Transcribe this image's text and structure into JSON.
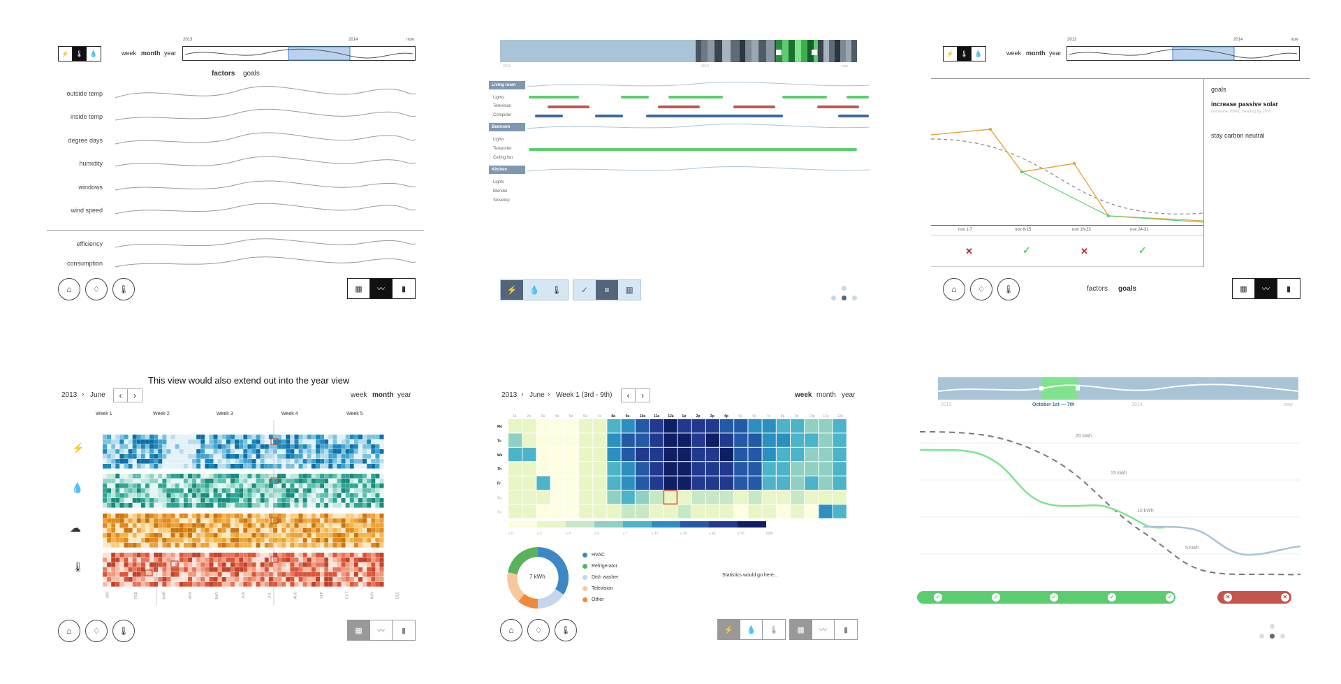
{
  "colors": {
    "green": "#5ccd6e",
    "red": "#c4554d",
    "blue": "#3b6a9c",
    "slate": "#7f98b0",
    "orange": "#e8a33d",
    "lightblue": "#a9c3d7"
  },
  "p1": {
    "timeline": {
      "start": "2013",
      "mid": "2014",
      "end": "now"
    },
    "period": {
      "week": "week",
      "month": "month",
      "year": "year"
    },
    "tabs": {
      "factors": "factors",
      "goals": "goals"
    },
    "rows": [
      "outside temp",
      "inside temp",
      "degree days",
      "humidity",
      "windows",
      "wind speed"
    ],
    "rows2": [
      "efficiency",
      "consumption"
    ],
    "icons": [
      "lightning-icon",
      "thermometer-icon",
      "drop-icon"
    ]
  },
  "p2": {
    "timeline": {
      "start": "2013",
      "mid": "2014",
      "end": "now"
    },
    "rooms": [
      {
        "name": "Living room",
        "items": [
          "Lights",
          "Television",
          "Computer"
        ]
      },
      {
        "name": "Bedroom",
        "items": [
          "Lights",
          "Teleporter",
          "Ceiling fan"
        ]
      },
      {
        "name": "Kitchen",
        "items": [
          "Lights",
          "Blender",
          "Stovetop"
        ]
      }
    ]
  },
  "p3": {
    "timeline": {
      "start": "2013",
      "mid": "2014",
      "end": "now"
    },
    "period": {
      "week": "week",
      "month": "month",
      "year": "year"
    },
    "goals_title": "goals",
    "goal1": "increase passive solar",
    "goal1_sub": "decrease HVAC heating by 20%",
    "goal2": "stay carbon neutral",
    "weeks": [
      "nov 1-7",
      "nov 8-15",
      "nov 16-23",
      "nov 24-31"
    ],
    "marks": [
      "✕",
      "✓",
      "✕",
      "✓"
    ],
    "tabs": {
      "factors": "factors",
      "goals": "goals"
    }
  },
  "p4": {
    "caption": "This view would also extend out into the year view",
    "crumb": {
      "year": "2013",
      "sep": "›",
      "month": "June"
    },
    "nav": {
      "prev": "‹",
      "next": "›"
    },
    "period": {
      "week": "week",
      "month": "month",
      "year": "year"
    },
    "weeks": [
      "Week 1",
      "Week 2",
      "Week 3",
      "Week 4",
      "Week 5"
    ],
    "months": [
      "JAN",
      "FEB",
      "MAR",
      "APR",
      "MAY",
      "JUN",
      "JUL",
      "AUG",
      "SEP",
      "OCT",
      "NOV",
      "DEC"
    ]
  },
  "p5": {
    "crumb": {
      "year": "2013",
      "sep1": "›",
      "month": "June",
      "sep2": "›",
      "week": "Week 1 (3rd - 9th)"
    },
    "nav": {
      "prev": "‹",
      "next": "›"
    },
    "period": {
      "week": "week",
      "month": "month",
      "year": "year"
    },
    "hours": [
      "1a",
      "2a",
      "3a",
      "4a",
      "5a",
      "6a",
      "7a",
      "8a",
      "9a",
      "10a",
      "11a",
      "12a",
      "1p",
      "2p",
      "3p",
      "4p",
      "5p",
      "6p",
      "7p",
      "8p",
      "9p",
      "10p",
      "11p",
      "12p"
    ],
    "days": [
      "Mo",
      "Tu",
      "We",
      "Th",
      "Fr",
      "Sa",
      "Su"
    ],
    "scale": [
      "≤ 0",
      "≤ 2",
      "≤ 4",
      "≤ 5",
      "≤ 7",
      "≤ 15",
      "≤ 30",
      "≤ 42",
      "≤ 56",
      "kWh"
    ],
    "donut_center": "7 kWh",
    "legend": [
      "HVAC",
      "Refrigerator",
      "Dish washer",
      "Television",
      "Other"
    ],
    "stats": "Statistics would go here..."
  },
  "p6": {
    "timeline": {
      "start": "2013",
      "mid": "2014",
      "end": "now",
      "range": "October 1st — 7th"
    },
    "kwh": [
      "20 kWh",
      "15 kWh",
      "10 kWh",
      "5 kWh"
    ]
  }
}
